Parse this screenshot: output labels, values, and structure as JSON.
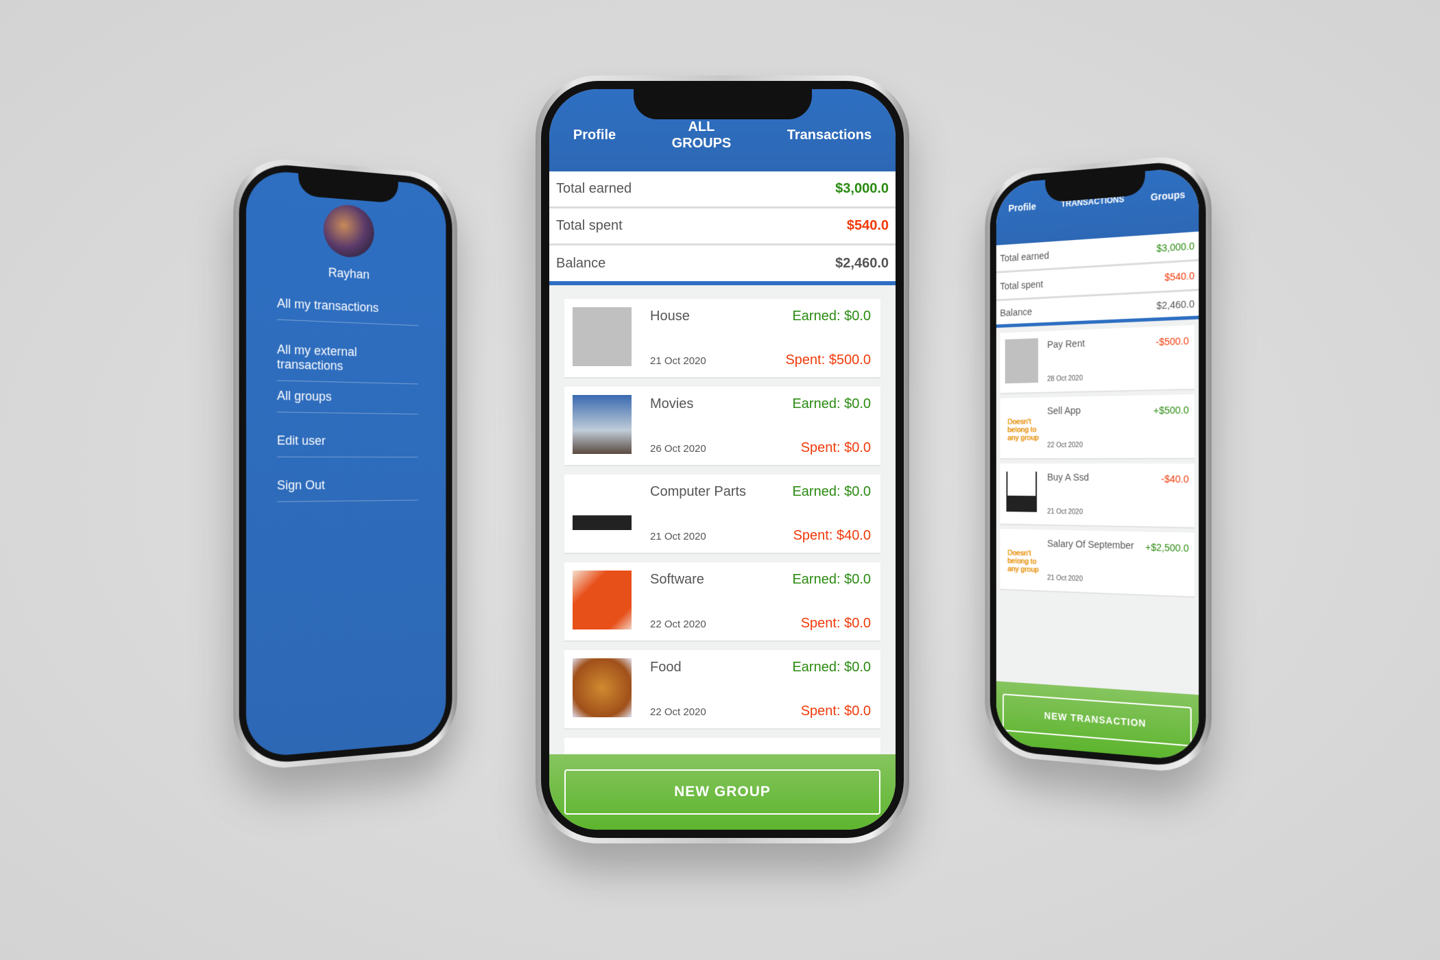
{
  "left_phone": {
    "user_name": "Rayhan",
    "menu": [
      "All my transactions",
      "All my external transactions",
      "All groups",
      "Edit user",
      "Sign Out"
    ]
  },
  "center_phone": {
    "tabs": {
      "profile": "Profile",
      "all_groups": "ALL GROUPS",
      "transactions": "Transactions"
    },
    "summary": [
      {
        "label": "Total earned",
        "value": "$3,000.0",
        "color": "green"
      },
      {
        "label": "Total spent",
        "value": "$540.0",
        "color": "red"
      },
      {
        "label": "Balance",
        "value": "$2,460.0",
        "color": "gray"
      }
    ],
    "groups": [
      {
        "name": "House",
        "date": "21 Oct 2020",
        "earned": "Earned: $0.0",
        "spent": "Spent: $500.0",
        "image": "placeholder-image"
      },
      {
        "name": "Movies",
        "date": "26 Oct 2020",
        "earned": "Earned: $0.0",
        "spent": "Spent: $0.0",
        "image": "rocket-photo"
      },
      {
        "name": "Computer Parts",
        "date": "21 Oct 2020",
        "earned": "Earned: $0.0",
        "spent": "Spent: $40.0",
        "image": "router-photo"
      },
      {
        "name": "Software",
        "date": "22 Oct 2020",
        "earned": "Earned: $0.0",
        "spent": "Spent: $0.0",
        "image": "orange-package-photo"
      },
      {
        "name": "Food",
        "date": "22 Oct 2020",
        "earned": "Earned: $0.0",
        "spent": "Spent: $0.0",
        "image": "fried-chicken-photo"
      }
    ],
    "new_group_label": "NEW GROUP"
  },
  "right_phone": {
    "tabs": {
      "profile": "Profile",
      "transactions": "TRANSACTIONS",
      "groups": "Groups"
    },
    "summary": [
      {
        "label": "Total earned",
        "value": "$3,000.0",
        "color": "green"
      },
      {
        "label": "Total spent",
        "value": "$540.0",
        "color": "red"
      },
      {
        "label": "Balance",
        "value": "$2,460.0",
        "color": "gray"
      }
    ],
    "transactions": [
      {
        "name": "Pay Rent",
        "date": "28 Oct 2020",
        "amount": "-$500.0",
        "color": "red",
        "image": "placeholder-image"
      },
      {
        "name": "Sell App",
        "date": "22 Oct 2020",
        "amount": "+$500.0",
        "color": "green",
        "no_group": "Doesn't belong to any group"
      },
      {
        "name": "Buy A Ssd",
        "date": "21 Oct 2020",
        "amount": "-$40.0",
        "color": "red",
        "image": "router-photo"
      },
      {
        "name": "Salary Of September",
        "date": "21 Oct 2020",
        "amount": "+$2,500.0",
        "color": "green",
        "no_group": "Doesn't belong to any group"
      }
    ],
    "new_transaction_label": "NEW TRANSACTION"
  },
  "colors": {
    "header_blue": "#2e6fc2",
    "button_green": "#5db52e",
    "earned_green": "#2a8a10",
    "spent_red": "#f03a0a"
  }
}
